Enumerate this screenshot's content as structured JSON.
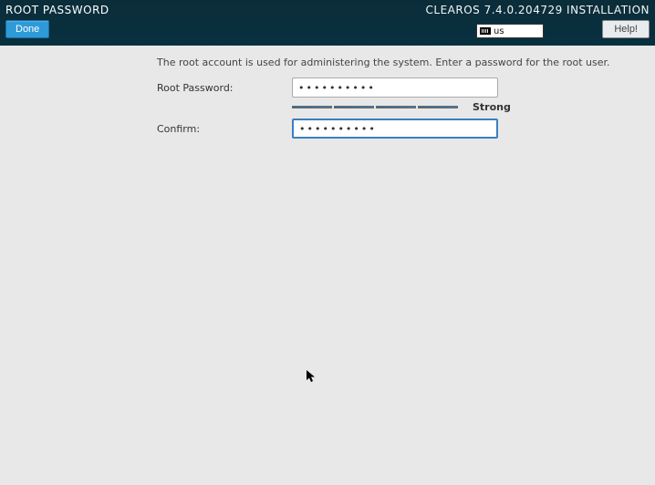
{
  "header": {
    "screen_title": "ROOT PASSWORD",
    "product_title": "CLEAROS 7.4.0.204729 INSTALLATION",
    "done_label": "Done",
    "help_label": "Help!",
    "keyboard_layout": "us"
  },
  "form": {
    "description": "The root account is used for administering the system.  Enter a password for the root user.",
    "root_password_label": "Root Password:",
    "confirm_label": "Confirm:",
    "root_password_masked": "••••••••••",
    "confirm_password_masked": "••••••••••",
    "strength_label": "Strong",
    "strength_segments": 4
  }
}
